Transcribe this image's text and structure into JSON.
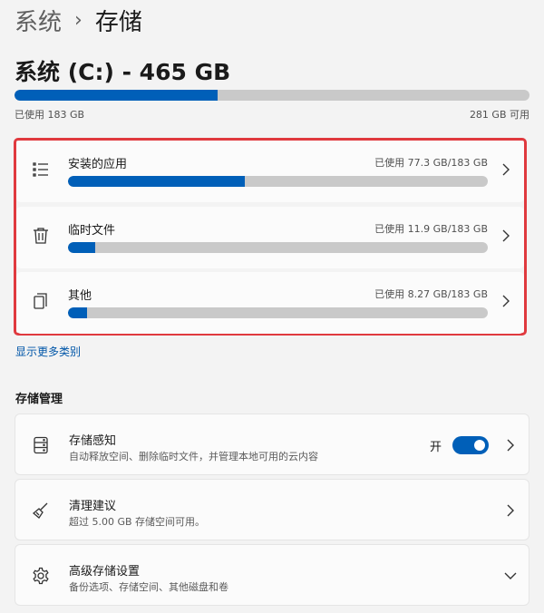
{
  "breadcrumb": {
    "parent": "系统",
    "separator": "›",
    "current": "存储"
  },
  "drive": {
    "title": "系统 (C:) - 465 GB",
    "used_text": "已使用 183 GB",
    "free_text": "281 GB 可用",
    "used_fraction": 0.394
  },
  "categories": [
    {
      "label": "安装的应用",
      "usage": "已使用 77.3 GB/183 GB",
      "fraction": 0.422,
      "icon": "list-icon"
    },
    {
      "label": "临时文件",
      "usage": "已使用 11.9 GB/183 GB",
      "fraction": 0.065,
      "icon": "trash-icon"
    },
    {
      "label": "其他",
      "usage": "已使用 8.27 GB/183 GB",
      "fraction": 0.045,
      "icon": "documents-icon"
    }
  ],
  "more_link": "显示更多类别",
  "management": {
    "title": "存储管理",
    "items": [
      {
        "title": "存储感知",
        "subtitle": "自动释放空间、删除临时文件，并管理本地可用的云内容",
        "toggle_label": "开",
        "toggle_on": true,
        "icon": "storage-drive-icon"
      },
      {
        "title": "清理建议",
        "subtitle": "超过 5.00 GB 存储空间可用。",
        "icon": "broom-icon"
      },
      {
        "title": "高级存储设置",
        "subtitle": "备份选项、存储空间、其他磁盘和卷",
        "icon": "gear-icon"
      }
    ]
  },
  "colors": {
    "accent": "#005fb8",
    "highlight_border": "#e0393e",
    "bar_track": "#c9c9c9"
  }
}
